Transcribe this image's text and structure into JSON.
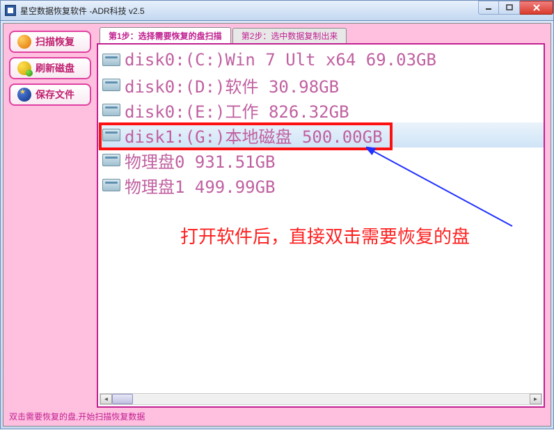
{
  "window": {
    "title": "星空数据恢复软件   -ADR科技 v2.5"
  },
  "sidebar": {
    "scan": "扫描恢复",
    "refresh": "刷新磁盘",
    "save": "保存文件"
  },
  "tabs": {
    "step1": "第1步：选择需要恢复的盘扫描",
    "step2": "第2步：选中数据复制出来"
  },
  "disks": [
    {
      "label": "disk0:(C:)Win 7 Ult x64 69.03GB",
      "selected": false
    },
    {
      "label": "disk0:(D:)软件 30.98GB",
      "selected": false
    },
    {
      "label": "disk0:(E:)工作 826.32GB",
      "selected": false
    },
    {
      "label": "disk1:(G:)本地磁盘 500.00GB",
      "selected": true
    },
    {
      "label": "物理盘0 931.51GB",
      "selected": false
    },
    {
      "label": "物理盘1 499.99GB",
      "selected": false
    }
  ],
  "annotation": "打开软件后，直接双击需要恢复的盘",
  "status": "双击需要恢复的盘,开始扫描恢复数据"
}
